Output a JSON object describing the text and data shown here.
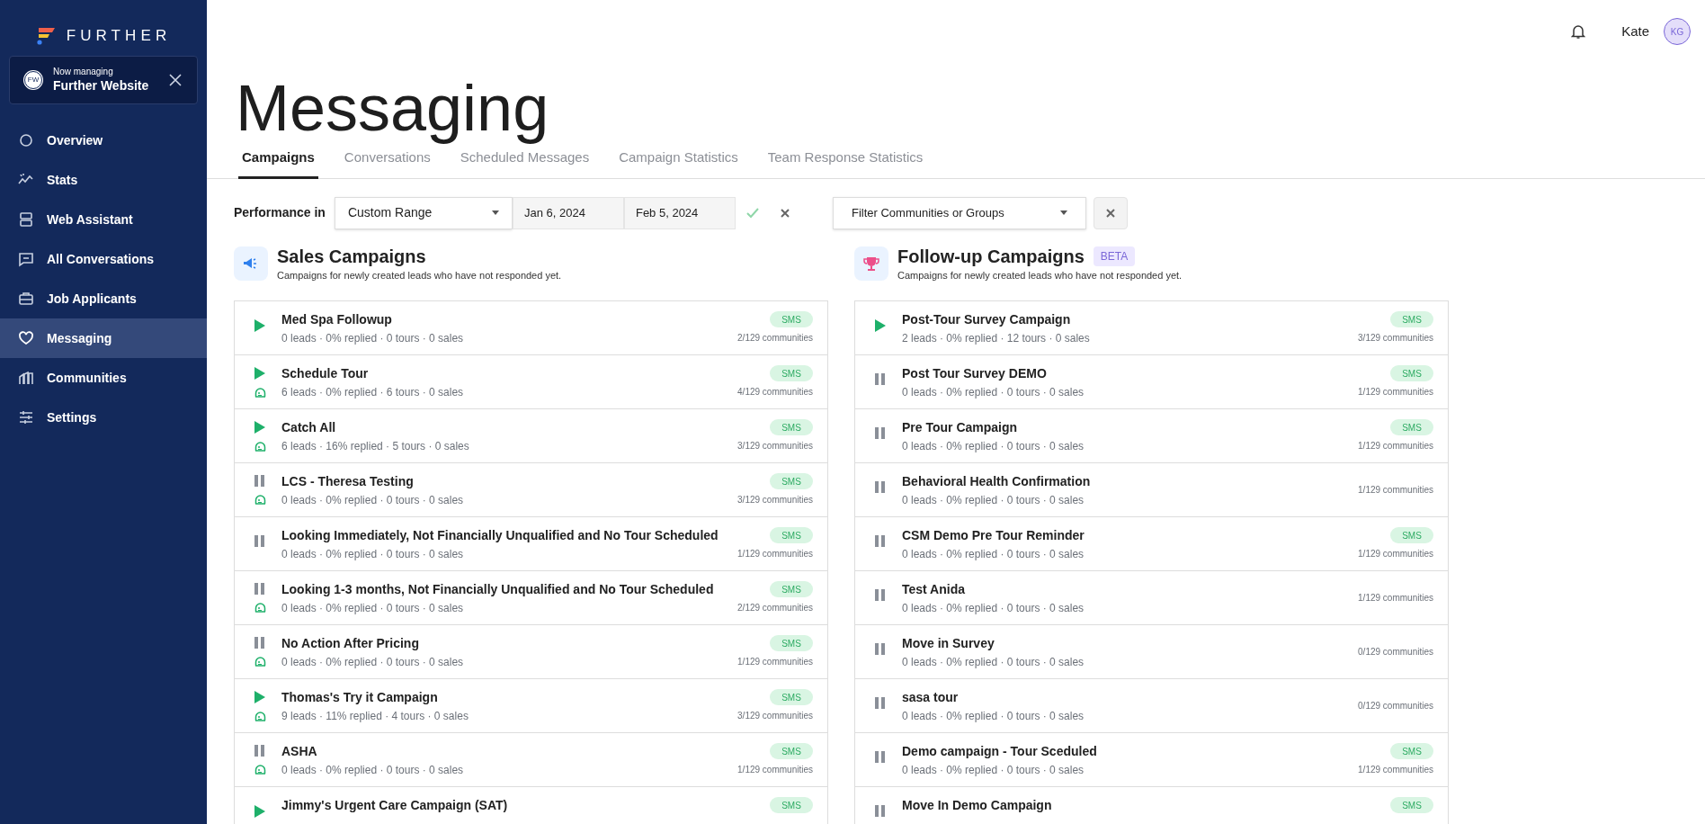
{
  "brand": {
    "name": "FURTHER"
  },
  "managing": {
    "label": "Now managing",
    "initials": "FW",
    "name": "Further Website"
  },
  "sidebar": {
    "items": [
      {
        "label": "Overview",
        "selected": false
      },
      {
        "label": "Stats",
        "selected": false
      },
      {
        "label": "Web Assistant",
        "selected": false
      },
      {
        "label": "All Conversations",
        "selected": false
      },
      {
        "label": "Job Applicants",
        "selected": false
      },
      {
        "label": "Messaging",
        "selected": true
      },
      {
        "label": "Communities",
        "selected": false
      },
      {
        "label": "Settings",
        "selected": false
      }
    ]
  },
  "user": {
    "name": "Kate",
    "initials": "KG"
  },
  "page": {
    "title": "Messaging"
  },
  "tabs": [
    {
      "label": "Campaigns",
      "selected": true
    },
    {
      "label": "Conversations",
      "selected": false
    },
    {
      "label": "Scheduled Messages",
      "selected": false
    },
    {
      "label": "Campaign Statistics",
      "selected": false
    },
    {
      "label": "Team Response Statistics",
      "selected": false
    }
  ],
  "filters": {
    "label": "Performance in",
    "range": "Custom Range",
    "start_date": "Jan 6, 2024",
    "end_date": "Feb 5, 2024",
    "communities_placeholder": "Filter Communities or Groups"
  },
  "sections": [
    {
      "kind": "sales",
      "title": "Sales Campaigns",
      "subtitle": "Campaigns for newly created leads who have not responded yet.",
      "campaigns": [
        {
          "name": "Med Spa Followup",
          "running": true,
          "agent": false,
          "stats": "0 leads · 0% replied · 0 tours · 0 sales",
          "channel": "SMS",
          "communities": "2/129 communities"
        },
        {
          "name": "Schedule Tour",
          "running": true,
          "agent": true,
          "stats": "6 leads · 0% replied · 6 tours · 0 sales",
          "channel": "SMS",
          "communities": "4/129 communities"
        },
        {
          "name": "Catch All",
          "running": true,
          "agent": true,
          "stats": "6 leads · 16% replied · 5 tours · 0 sales",
          "channel": "SMS",
          "communities": "3/129 communities"
        },
        {
          "name": "LCS - Theresa Testing",
          "running": false,
          "agent": true,
          "stats": "0 leads · 0% replied · 0 tours · 0 sales",
          "channel": "SMS",
          "communities": "3/129 communities"
        },
        {
          "name": "Looking Immediately, Not Financially Unqualified and No Tour Scheduled",
          "running": false,
          "agent": false,
          "stats": "0 leads · 0% replied · 0 tours · 0 sales",
          "channel": "SMS",
          "communities": "1/129 communities"
        },
        {
          "name": "Looking 1-3 months, Not Financially Unqualified and No Tour Scheduled",
          "running": false,
          "agent": true,
          "stats": "0 leads · 0% replied · 0 tours · 0 sales",
          "channel": "SMS",
          "communities": "2/129 communities"
        },
        {
          "name": "No Action After Pricing",
          "running": false,
          "agent": true,
          "stats": "0 leads · 0% replied · 0 tours · 0 sales",
          "channel": "SMS",
          "communities": "1/129 communities"
        },
        {
          "name": "Thomas's Try it Campaign",
          "running": true,
          "agent": true,
          "stats": "9 leads · 11% replied · 4 tours · 0 sales",
          "channel": "SMS",
          "communities": "3/129 communities"
        },
        {
          "name": "ASHA",
          "running": false,
          "agent": true,
          "stats": "0 leads · 0% replied · 0 tours · 0 sales",
          "channel": "SMS",
          "communities": "1/129 communities"
        },
        {
          "name": "Jimmy's Urgent Care Campaign (SAT)",
          "running": true,
          "agent": false,
          "channel": "SMS"
        }
      ]
    },
    {
      "kind": "followup",
      "title": "Follow-up Campaigns",
      "badge": "BETA",
      "subtitle": "Campaigns for newly created leads who have not responded yet.",
      "campaigns": [
        {
          "name": "Post-Tour Survey Campaign",
          "running": true,
          "agent": false,
          "stats": "2 leads · 0% replied · 12 tours · 0 sales",
          "channel": "SMS",
          "communities": "3/129 communities"
        },
        {
          "name": "Post Tour Survey DEMO",
          "running": false,
          "agent": false,
          "stats": "0 leads · 0% replied · 0 tours · 0 sales",
          "channel": "SMS",
          "communities": "1/129 communities"
        },
        {
          "name": "Pre Tour Campaign",
          "running": false,
          "agent": false,
          "stats": "0 leads · 0% replied · 0 tours · 0 sales",
          "channel": "SMS",
          "communities": "1/129 communities"
        },
        {
          "name": "Behavioral Health Confirmation",
          "running": false,
          "agent": false,
          "stats": "0 leads · 0% replied · 0 tours · 0 sales",
          "communities": "1/129 communities"
        },
        {
          "name": "CSM Demo Pre Tour Reminder",
          "running": false,
          "agent": false,
          "stats": "0 leads · 0% replied · 0 tours · 0 sales",
          "channel": "SMS",
          "communities": "1/129 communities"
        },
        {
          "name": "Test Anida",
          "running": false,
          "agent": false,
          "stats": "0 leads · 0% replied · 0 tours · 0 sales",
          "communities": "1/129 communities"
        },
        {
          "name": "Move in Survey",
          "running": false,
          "agent": false,
          "stats": "0 leads · 0% replied · 0 tours · 0 sales",
          "communities": "0/129 communities"
        },
        {
          "name": "sasa tour",
          "running": false,
          "agent": false,
          "stats": "0 leads · 0% replied · 0 tours · 0 sales",
          "communities": "0/129 communities"
        },
        {
          "name": "Demo campaign - Tour Sceduled",
          "running": false,
          "agent": false,
          "stats": "0 leads · 0% replied · 0 tours · 0 sales",
          "channel": "SMS",
          "communities": "1/129 communities"
        },
        {
          "name": "Move In Demo Campaign",
          "running": false,
          "agent": false,
          "channel": "SMS"
        }
      ]
    }
  ]
}
